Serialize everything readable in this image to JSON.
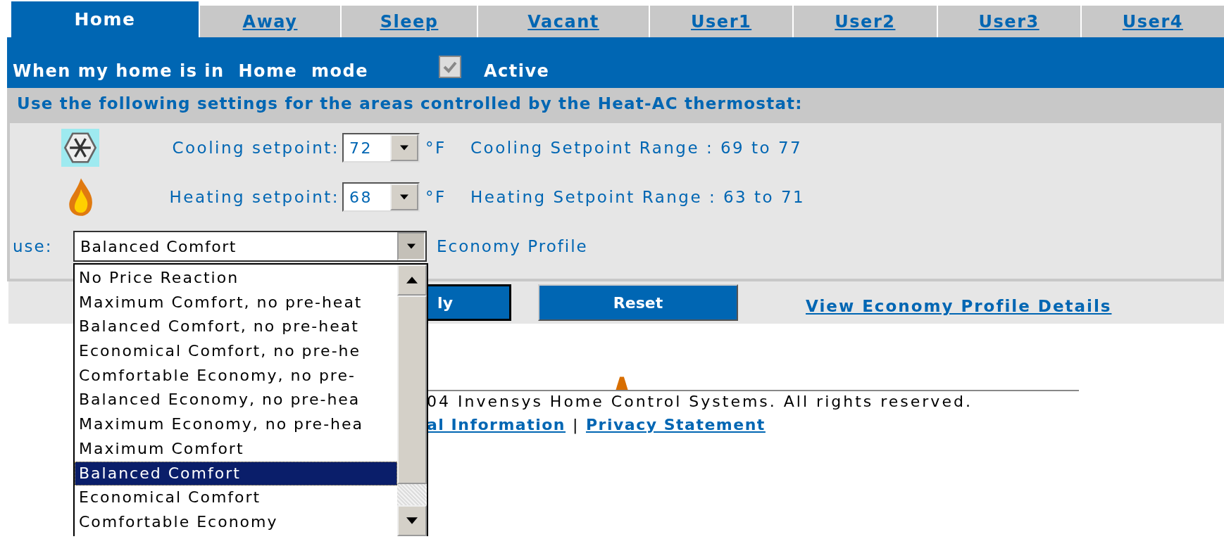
{
  "tabs": [
    {
      "label": "Home",
      "selected": true
    },
    {
      "label": "Away",
      "selected": false
    },
    {
      "label": "Sleep",
      "selected": false
    },
    {
      "label": "Vacant",
      "selected": false
    },
    {
      "label": "User1",
      "selected": false
    },
    {
      "label": "User2",
      "selected": false
    },
    {
      "label": "User3",
      "selected": false
    },
    {
      "label": "User4",
      "selected": false
    }
  ],
  "mode_bar": {
    "text": "When my home is in  Home  mode",
    "active": {
      "label": "Active",
      "checked": true
    }
  },
  "settings": {
    "heading": "Use the following settings for the areas controlled by the Heat-AC thermostat:",
    "setpoints": [
      {
        "kind": "cooling",
        "label": "Cooling setpoint:",
        "value": "72",
        "unit": "°F",
        "range": "Cooling Setpoint Range : 69 to 77"
      },
      {
        "kind": "heating",
        "label": "Heating setpoint:",
        "value": "68",
        "unit": "°F",
        "range": "Heating Setpoint Range : 63 to 71"
      }
    ],
    "profile": {
      "label": "use:",
      "value": "Balanced Comfort",
      "caption": "Economy Profile",
      "expanded": true,
      "options": [
        {
          "label": "No Price Reaction",
          "selected": false
        },
        {
          "label": "Maximum Comfort, no pre-heat",
          "selected": false
        },
        {
          "label": "Balanced Comfort, no pre-heat",
          "selected": false
        },
        {
          "label": "Economical Comfort, no pre-he",
          "selected": false
        },
        {
          "label": "Comfortable Economy, no pre-",
          "selected": false
        },
        {
          "label": "Balanced Economy, no pre-hea",
          "selected": false
        },
        {
          "label": "Maximum Economy, no pre-hea",
          "selected": false
        },
        {
          "label": "Maximum Comfort",
          "selected": false
        },
        {
          "label": "Balanced Comfort",
          "selected": true
        },
        {
          "label": "Economical Comfort",
          "selected": false
        },
        {
          "label": "Comfortable Economy",
          "selected": false
        }
      ]
    }
  },
  "buttons": [
    {
      "label": "ly"
    },
    {
      "label": "Reset"
    }
  ],
  "details_link": "View Economy Profile Details",
  "footer": {
    "copyright": "04 Invensys Home Control Systems. All rights reserved.",
    "links": [
      "al Information",
      "Privacy Statement"
    ],
    "separator": "|"
  }
}
